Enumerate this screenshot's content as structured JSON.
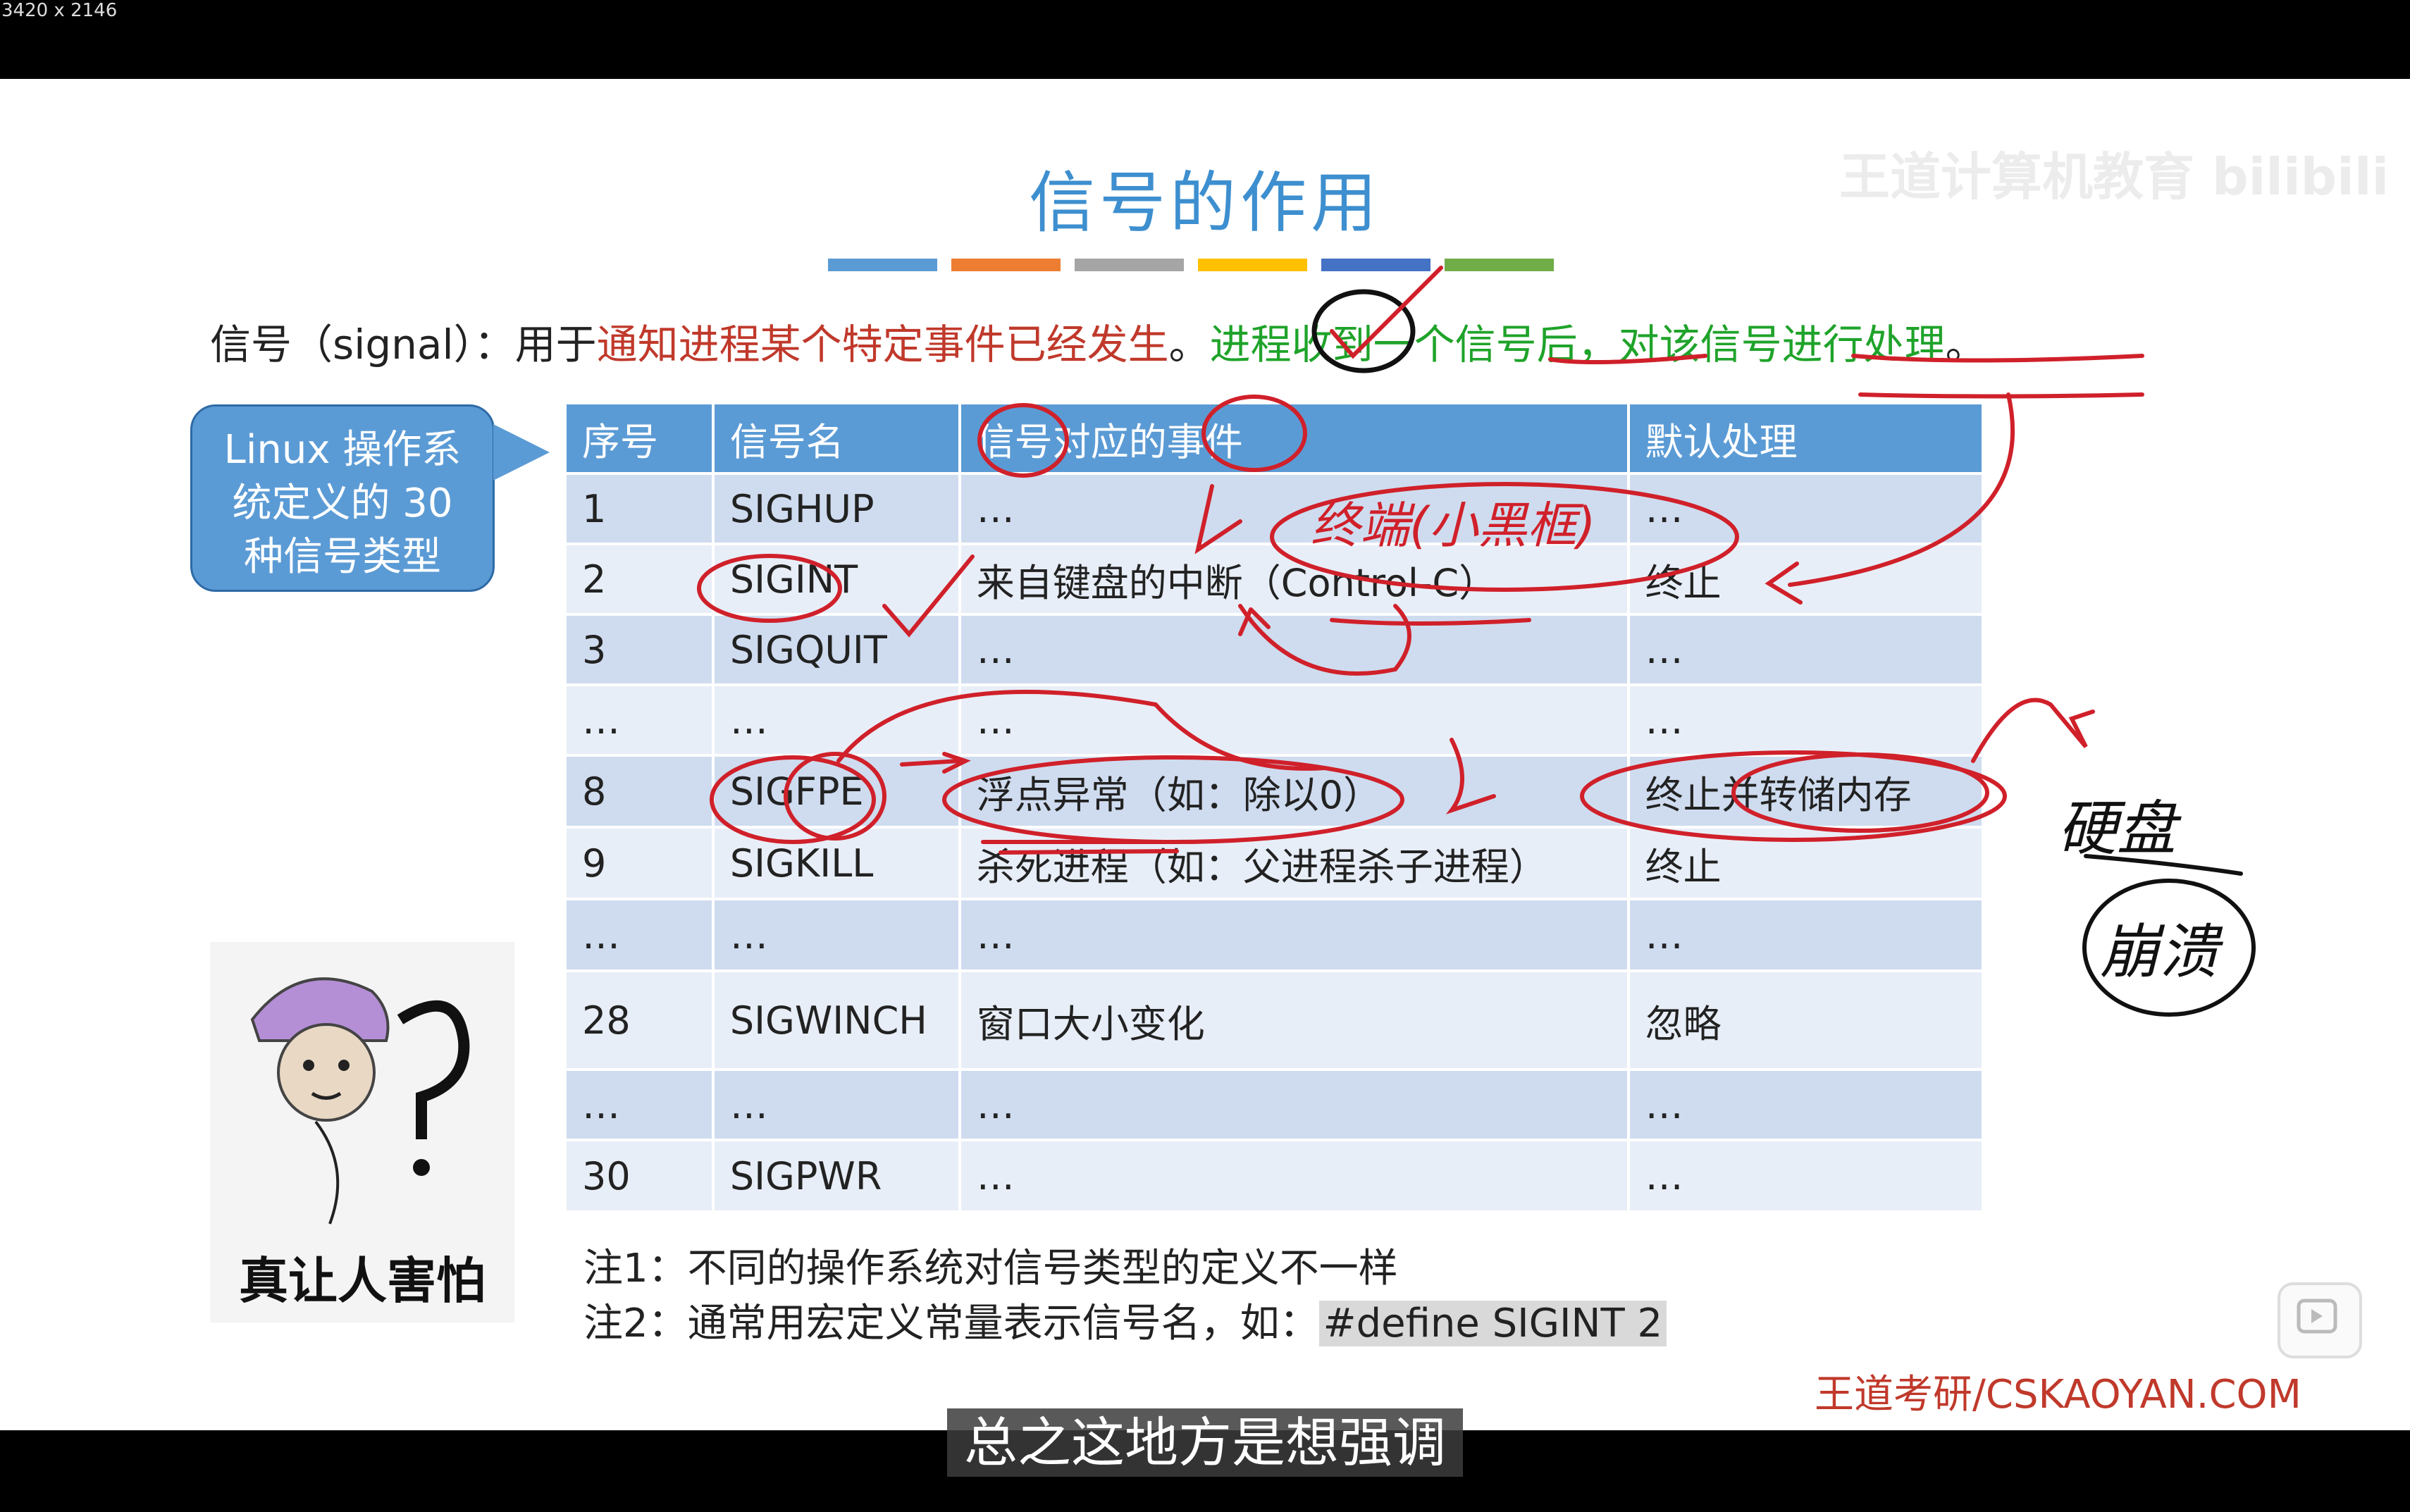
{
  "window": {
    "size_label": "3420 x 2146"
  },
  "slide": {
    "title": "信号的作用",
    "watermark": "王道计算机教育 bilibili",
    "intro_prefix": "信号（signal）：用于",
    "intro_red": "通知进程某个特定事件已经发生",
    "intro_sep": "。",
    "intro_green": "进程收到一个信号后，对该信号进行处理",
    "intro_end": "。",
    "callout": [
      "Linux 操作系",
      "统定义的 30",
      "种信号类型"
    ],
    "table": {
      "headers": [
        "序号",
        "信号名",
        "信号对应的事件",
        "默认处理"
      ],
      "rows": [
        [
          "1",
          "SIGHUP",
          "…",
          "…"
        ],
        [
          "2",
          "SIGINT",
          "来自键盘的中断（Control-C）",
          "终止"
        ],
        [
          "3",
          "SIGQUIT",
          "…",
          "…"
        ],
        [
          "…",
          "…",
          "…",
          "…"
        ],
        [
          "8",
          "SIGFPE",
          "浮点异常（如：除以0）",
          "终止并转储内存"
        ],
        [
          "9",
          "SIGKILL",
          "杀死进程（如：父进程杀子进程）",
          "终止"
        ],
        [
          "…",
          "…",
          "…",
          "…"
        ],
        [
          "28",
          "SIGWINCH",
          "窗口大小变化",
          "忽略"
        ],
        [
          "…",
          "…",
          "…",
          "…"
        ],
        [
          "30",
          "SIGPWR",
          "…",
          "…"
        ]
      ]
    },
    "notes": {
      "note1": "注1：不同的操作系统对信号类型的定义不一样",
      "note2_prefix": "注2：通常用宏定义常量表示信号名，如：",
      "note2_code": "#define SIGINT 2"
    },
    "meme_caption": "真让人害怕",
    "brand": "王道考研/CSKAOYAN.COM",
    "handwriting": {
      "terminal": "终端(小黑框)",
      "disk": "硬盘",
      "crash": "崩溃"
    }
  },
  "player": {
    "subtitle": "总之这地方是想强调"
  },
  "colors": {
    "title": "#3d8fcf",
    "header_bg": "#5b9bd5",
    "accent_red": "#c0392b",
    "accent_green": "#1fa32a",
    "bars": [
      "#5b9bd5",
      "#ed7d31",
      "#a5a5a5",
      "#ffc000",
      "#4472c4",
      "#70ad47"
    ]
  }
}
